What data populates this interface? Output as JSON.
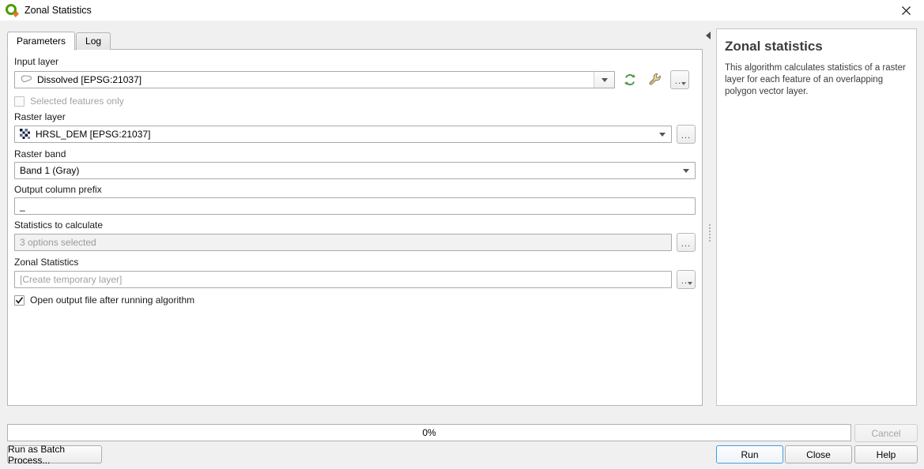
{
  "window": {
    "title": "Zonal Statistics",
    "logo_icon": "qgis-logo-icon",
    "close_icon": "close-icon"
  },
  "tabs": [
    {
      "label": "Parameters",
      "active": true
    },
    {
      "label": "Log",
      "active": false
    }
  ],
  "parameters": {
    "input_layer": {
      "label": "Input layer",
      "value": "Dissolved [EPSG:21037]",
      "layer_icon": "polygon-layer-icon",
      "dropdown_icon": "chevron-down-icon",
      "iterate_icon": "iterate-refresh-icon",
      "data_define_icon": "wrench-icon",
      "browse_label": "..."
    },
    "selected_features_only": {
      "label": "Selected features only",
      "checked": false,
      "enabled": false
    },
    "raster_layer": {
      "label": "Raster layer",
      "value": "HRSL_DEM [EPSG:21037]",
      "layer_icon": "raster-layer-icon",
      "dropdown_icon": "chevron-down-icon",
      "browse_label": "..."
    },
    "raster_band": {
      "label": "Raster band",
      "value": "Band 1 (Gray)",
      "dropdown_icon": "chevron-down-icon"
    },
    "output_column_prefix": {
      "label": "Output column prefix",
      "value": "_"
    },
    "statistics_to_calculate": {
      "label": "Statistics to calculate",
      "value": "3 options selected",
      "browse_label": "..."
    },
    "zonal_statistics_output": {
      "label": "Zonal Statistics",
      "placeholder": "[Create temporary layer]",
      "value": "",
      "browse_label": "..."
    },
    "open_output": {
      "label": "Open output file after running algorithm",
      "checked": true,
      "enabled": true
    }
  },
  "help": {
    "title": "Zonal statistics",
    "body": "This algorithm calculates statistics of a raster layer for each feature of an overlapping polygon vector layer.",
    "collapse_icon": "collapse-left-arrow-icon"
  },
  "footer": {
    "progress_text": "0%",
    "progress_percent": 0,
    "cancel_label": "Cancel",
    "batch_label": "Run as Batch Process...",
    "run_label": "Run",
    "close_label": "Close",
    "help_label": "Help"
  }
}
